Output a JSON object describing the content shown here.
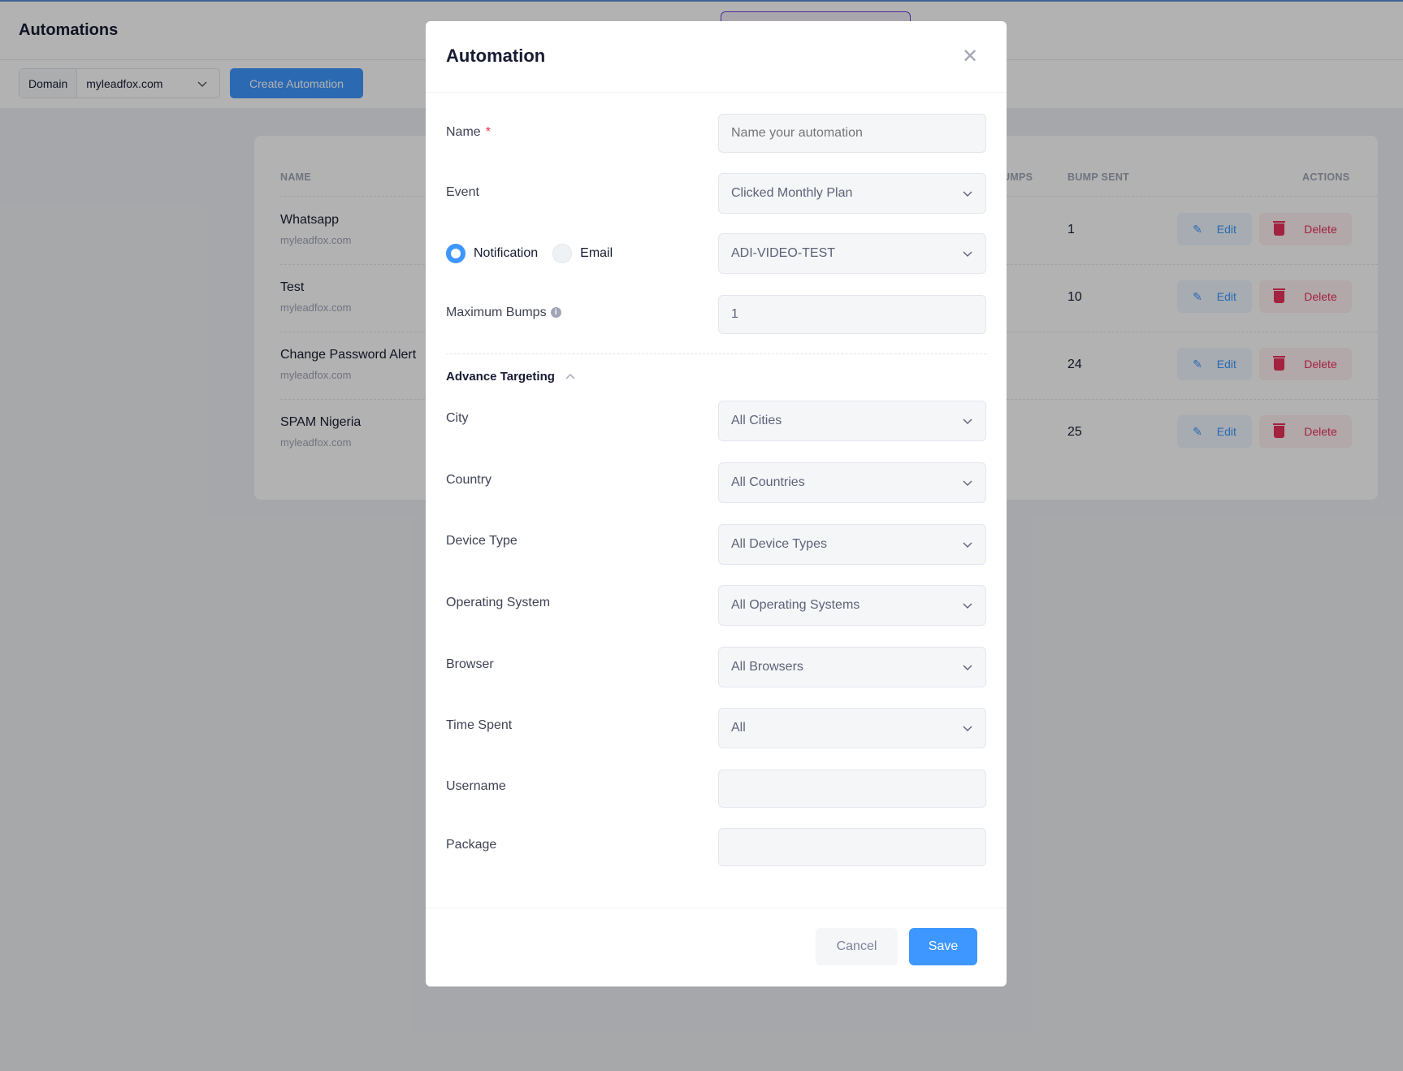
{
  "header": {
    "title": "Automations"
  },
  "toolbar": {
    "domain_label": "Domain",
    "domain_value": "myleadfox.com",
    "create_label": "Create Automation"
  },
  "table": {
    "columns": {
      "name": "NAME",
      "bumps": "UMPS",
      "bump_sent": "BUMP SENT",
      "actions": "ACTIONS"
    },
    "rows": [
      {
        "name": "Whatsapp",
        "domain": "myleadfox.com",
        "bump_sent": "1"
      },
      {
        "name": "Test",
        "domain": "myleadfox.com",
        "bump_sent": "10"
      },
      {
        "name": "Change Password Alert",
        "domain": "myleadfox.com",
        "bump_sent": "24"
      },
      {
        "name": "SPAM Nigeria",
        "domain": "myleadfox.com",
        "bump_sent": "25"
      }
    ],
    "edit_label": "Edit",
    "delete_label": "Delete"
  },
  "modal": {
    "title": "Automation",
    "name": {
      "label": "Name",
      "required": "*",
      "placeholder": "Name your automation",
      "value": ""
    },
    "event": {
      "label": "Event",
      "value": "Clicked Monthly Plan"
    },
    "channel": {
      "notification_label": "Notification",
      "email_label": "Email",
      "selected": "Notification",
      "value": "ADI-VIDEO-TEST"
    },
    "max_bumps": {
      "label": "Maximum Bumps",
      "info_icon": "i",
      "value": "1"
    },
    "advance_targeting": "Advance Targeting",
    "city": {
      "label": "City",
      "value": "All Cities"
    },
    "country": {
      "label": "Country",
      "value": "All Countries"
    },
    "device": {
      "label": "Device Type",
      "value": "All Device Types"
    },
    "os": {
      "label": "Operating System",
      "value": "All Operating Systems"
    },
    "browser": {
      "label": "Browser",
      "value": "All Browsers"
    },
    "time_spent": {
      "label": "Time Spent",
      "value": "All"
    },
    "username": {
      "label": "Username",
      "value": ""
    },
    "package": {
      "label": "Package",
      "value": ""
    },
    "cancel_label": "Cancel",
    "save_label": "Save"
  },
  "colors": {
    "primary": "#3e97ff",
    "danger": "#e8315c"
  }
}
